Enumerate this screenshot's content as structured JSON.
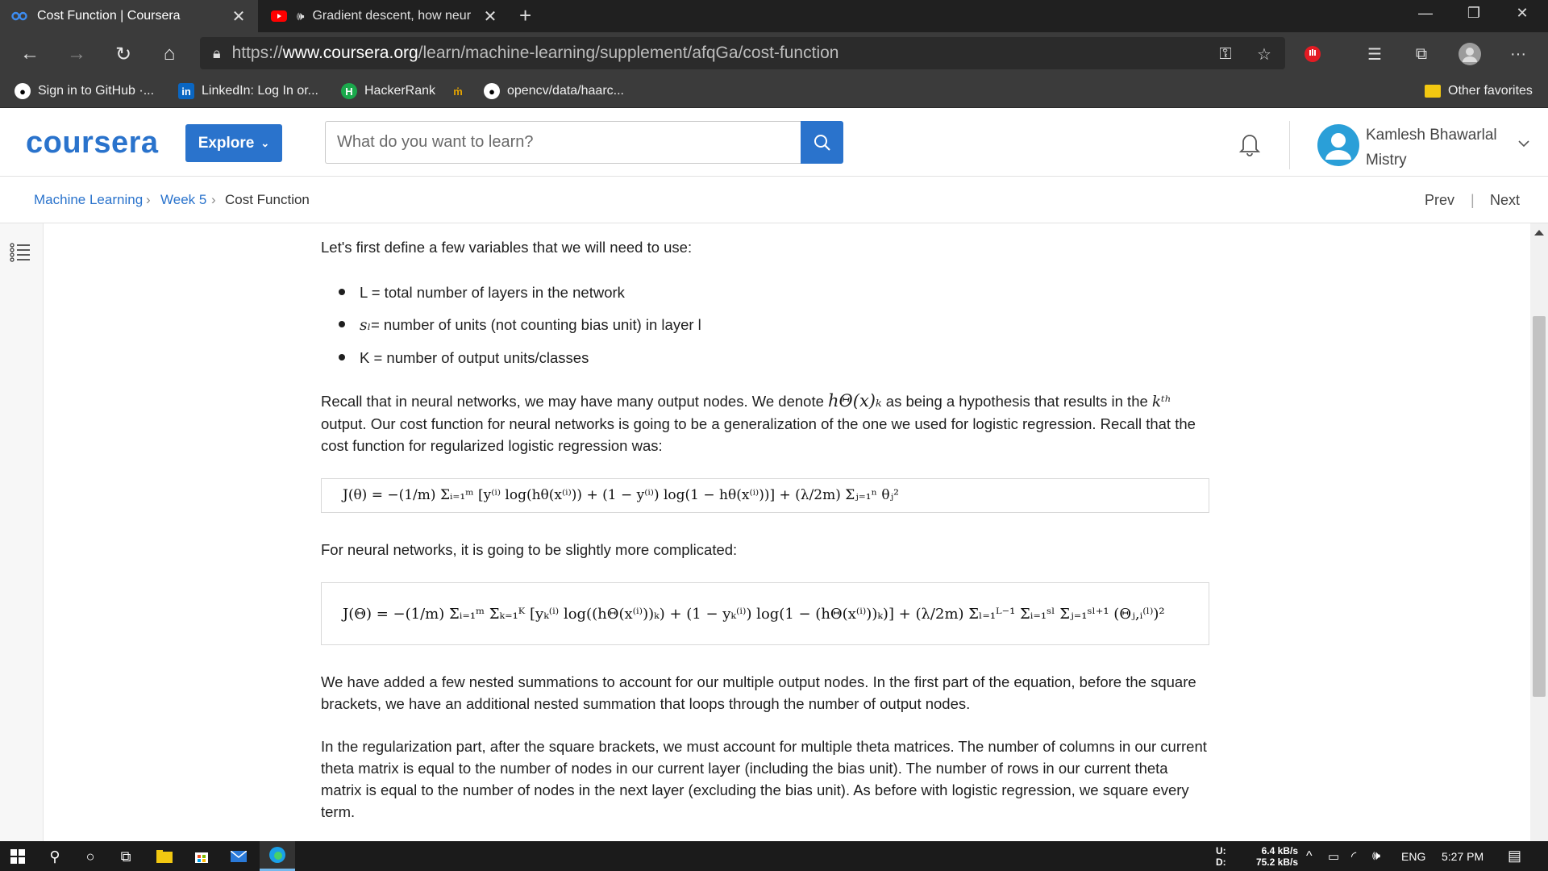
{
  "browser": {
    "tabs": [
      {
        "title": "Cost Function | Coursera",
        "active": true
      },
      {
        "title": "Gradient descent, how neur",
        "active": false
      }
    ],
    "url_protocol": "https://",
    "url_host": "www.coursera.org",
    "url_path": "/learn/machine-learning/supplement/afqGa/cost-function",
    "bookmarks": [
      {
        "label": "Sign in to GitHub ·...",
        "icon": "github-icon"
      },
      {
        "label": "LinkedIn: Log In or...",
        "icon": "linkedin-icon"
      },
      {
        "label": "HackerRank",
        "icon": "hackerrank-icon"
      },
      {
        "label": "",
        "icon": "bookmark-icon"
      },
      {
        "label": "opencv/data/haarc...",
        "icon": "github-icon"
      }
    ],
    "other_favorites": "Other favorites"
  },
  "header": {
    "logo": "coursera",
    "explore_label": "Explore",
    "search_placeholder": "What do you want to learn?",
    "user_first": "Kamlesh Bhawarlal",
    "user_last": "Mistry",
    "accent": "#2a73cc"
  },
  "breadcrumb": {
    "items": [
      "Machine Learning",
      "Week 5",
      "Cost Function"
    ],
    "prev": "Prev",
    "next": "Next"
  },
  "content": {
    "intro": "Let's first define a few variables that we will need to use:",
    "bullets": [
      {
        "prefix": "L = total number of layers in the network",
        "math": ""
      },
      {
        "math": "sₗ",
        "suffix": " = number of units (not counting bias unit) in layer l"
      },
      {
        "prefix": "K = number of output units/classes",
        "math": ""
      }
    ],
    "p2_a": "Recall that in neural networks, we may have many output nodes. We denote ",
    "p2_math": "hΘ(x)ₖ",
    "p2_b": " as being a hypothesis that results in the ",
    "p2_kth": "kᵗʰ",
    "p2_c": "output. Our cost function for neural networks is going to be a generalization of the one we used for logistic regression. Recall that the cost function for regularized logistic regression was:",
    "eq1": "J(θ) = −(1/m) Σᵢ₌₁ᵐ [y⁽ⁱ⁾ log(hθ(x⁽ⁱ⁾)) + (1 − y⁽ⁱ⁾) log(1 − hθ(x⁽ⁱ⁾))] + (λ/2m) Σⱼ₌₁ⁿ θⱼ²",
    "p3": "For neural networks, it is going to be slightly more complicated:",
    "eq2": "J(Θ) = −(1/m) Σᵢ₌₁ᵐ Σₖ₌₁ᴷ [yₖ⁽ⁱ⁾ log((hΘ(x⁽ⁱ⁾))ₖ) + (1 − yₖ⁽ⁱ⁾) log(1 − (hΘ(x⁽ⁱ⁾))ₖ)] + (λ/2m) Σₗ₌₁ᴸ⁻¹ Σᵢ₌₁ˢˡ Σⱼ₌₁ˢˡ⁺¹ (Θⱼ,ᵢ⁽ˡ⁾)²",
    "p4": "We have added a few nested summations to account for our multiple output nodes. In the first part of the equation, before the square brackets, we have an additional nested summation that loops through the number of output nodes.",
    "p5": "In the regularization part, after the square brackets, we must account for multiple theta matrices. The number of columns in our current theta matrix is equal to the number of nodes in our current layer (including the bias unit). The number of rows in our current theta matrix is equal to the number of nodes in the next layer (excluding the bias unit). As before with logistic regression, we square every term."
  },
  "taskbar": {
    "net_u_label": "U:",
    "net_d_label": "D:",
    "net_u": "6.4 kB/s",
    "net_d": "75.2 kB/s",
    "lang": "ENG",
    "time": "5:27 PM"
  }
}
